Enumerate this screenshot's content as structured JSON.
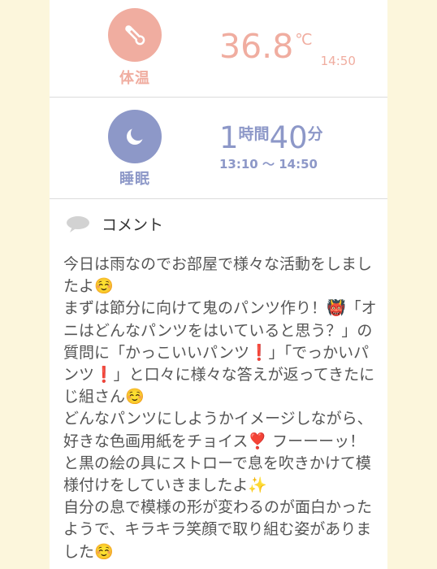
{
  "colors": {
    "page_bg": "#fcf6dc",
    "card_bg": "#ffffff",
    "temp_accent": "#f0ada0",
    "sleep_accent": "#8d98c8",
    "text": "#555555"
  },
  "temperature": {
    "label": "体温",
    "value": "36.8",
    "unit": "℃",
    "time": "14:50",
    "icon": "thermometer-icon"
  },
  "sleep": {
    "label": "睡眠",
    "hours": "1",
    "hours_unit": "時間",
    "minutes": "40",
    "minutes_unit": "分",
    "range": "13:10 〜 14:50",
    "icon": "moon-icon"
  },
  "comment": {
    "label": "コメント",
    "icon": "speech-bubble-icon",
    "text": "今日は雨なのでお部屋で様々な活動をしましたよ☺️\nまずは節分に向けて鬼のパンツ作り！👹「オニはどんなパンツをはいていると思う？」の質問に「かっこいいパンツ❗️」「でっかいパンツ❗️」と口々に様々な答えが返ってきたにじ組さん☺️\nどんなパンツにしようかイメージしながら、好きな色画用紙をチョイス❣️ フーーーッ！と黒の絵の具にストローで息を吹きかけて模様付けをしていきましたよ✨\n自分の息で模様の形が変わるのが面白かったようで、キラキラ笑顔で取り組む姿がありました☺️"
  }
}
